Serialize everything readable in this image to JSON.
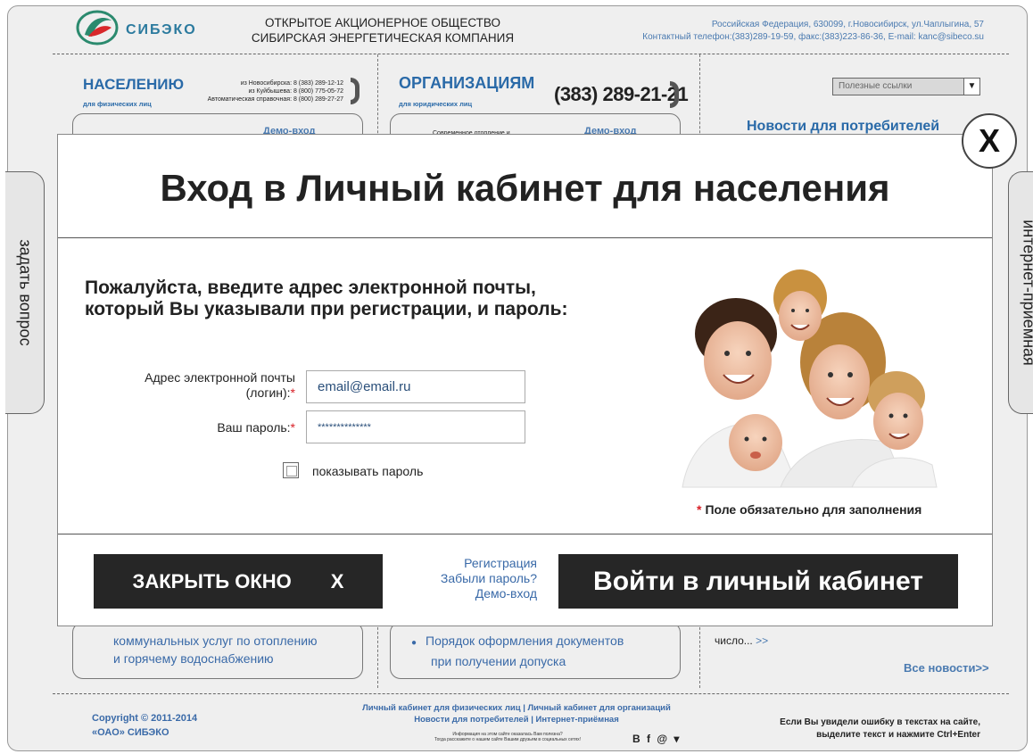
{
  "header": {
    "logo_text": "СИБЭКО",
    "company_line1": "ОТКРЫТОЕ АКЦИОНЕРНОЕ ОБЩЕСТВО",
    "company_line2": "СИБИРСКАЯ ЭНЕРГЕТИЧЕСКАЯ КОМПАНИЯ",
    "address": "Российская Федерация, 630099, г.Новосибирск, ул.Чаплыгина, 57",
    "contacts": "Контактный телефон:(383)289-19-59, факс:(383)223-86-36, E-mail: kanc@sibeco.su"
  },
  "population": {
    "title": "НАСЕЛЕНИЮ",
    "subtitle": "для физических лиц",
    "phone1": "из Новосибирска: 8 (383) 289-12-12",
    "phone2": "из Куйбышева: 8 (800) 775-05-72",
    "phone3": "Автоматическая справочная: 8 (800) 289-27-27",
    "demo": "Демо-вход",
    "bottom_line1": "коммунальных услуг по отоплению",
    "bottom_line2": "и горячему водоснабжению"
  },
  "organizations": {
    "title": "ОРГАНИЗАЦИЯМ",
    "subtitle": "для юридических лиц",
    "phone": "(383) 289-21-21",
    "item_small": "Современное отопление и",
    "demo": "Демо-вход",
    "bottom_line1": "Порядок оформления документов",
    "bottom_line2": "при получении допуска"
  },
  "news": {
    "select_label": "Полезные ссылки",
    "title": "Новости для потребителей",
    "item_tail": "число...",
    "more": ">>",
    "all_news": "Все новости>>"
  },
  "side_tabs": {
    "left": "задать вопрос",
    "right": "интернет-приемная"
  },
  "footer": {
    "copyright_line1": "Copyright © 2011-2014",
    "copyright_line2": "«ОАО» СИБЭКО",
    "links_line1": "Личный кабинет для физических лиц | Личный кабинет для организаций",
    "links_line2": "Новости для потребителей  | Интернет-приёмная",
    "small_line1": "Информация на этом сайте оказалась Вам полезна?",
    "small_line2": "Тогда расскажите о нашем сайте Вашим друзьям в социальных сетях!",
    "social": "B f @ ▾",
    "error_line1": "Если Вы увидели ошибку в текстах на сайте,",
    "error_line2": "выделите текст и нажмите Ctrl+Enter"
  },
  "modal": {
    "title": "Вход в Личный кабинет для населения",
    "instruction_line1": "Пожалуйста, введите адрес электронной почты,",
    "instruction_line2": "который Вы указывали при регистрации, и пароль:",
    "email_label_line1": "Адрес электронной почты",
    "email_label_line2": "(логин):",
    "email_value": "email@email.ru",
    "password_label": "Ваш пароль:",
    "password_value": "**************",
    "required_mark": "*",
    "show_password_label": "показывать пароль",
    "required_note": "Поле обязательно для заполнения",
    "close_button_label": "ЗАКРЫТЬ ОКНО",
    "close_button_x": "X",
    "register_link": "Регистрация",
    "forgot_link": "Забыли пароль?",
    "demo_link": "Демо-вход",
    "login_button_label": "Войти в личный кабинет",
    "close_circle": "X"
  },
  "colors": {
    "accent_blue": "#2a6aa8",
    "dark_button": "#262626",
    "required_red": "#d81f26"
  }
}
